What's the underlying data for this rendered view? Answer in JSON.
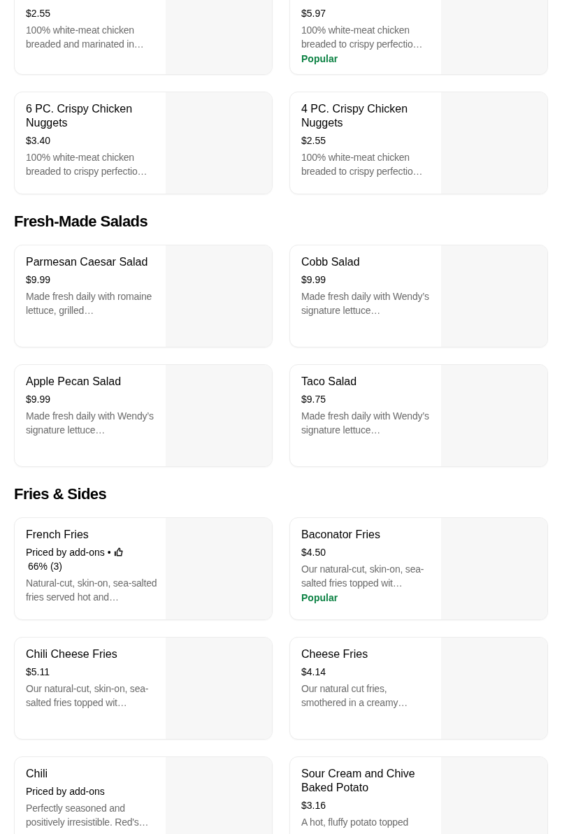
{
  "sections": [
    {
      "items": [
        {
          "price": "$2.55",
          "description": "100% white-meat chicken breaded and marinated in…"
        },
        {
          "price": "$5.97",
          "description": "100% white-meat chicken breaded to crispy perfectio…",
          "badge": "Popular"
        },
        {
          "title": "6 PC. Crispy Chicken Nuggets",
          "price": "$3.40",
          "description": "100% white-meat chicken breaded to crispy perfectio…"
        },
        {
          "title": "4 PC. Crispy Chicken Nuggets",
          "price": "$2.55",
          "description": "100% white-meat chicken breaded to crispy perfectio…"
        }
      ]
    },
    {
      "heading": "Fresh-Made Salads",
      "items": [
        {
          "title": "Parmesan Caesar Salad",
          "price": "$9.99",
          "description": "Made fresh daily with romaine lettuce, grilled…"
        },
        {
          "title": "Cobb Salad",
          "price": "$9.99",
          "description": "Made fresh daily with Wendy’s signature lettuce…"
        },
        {
          "title": "Apple Pecan Salad",
          "price": "$9.99",
          "description": "Made fresh daily with Wendy’s signature lettuce…"
        },
        {
          "title": "Taco Salad",
          "price": "$9.75",
          "description": "Made fresh daily with Wendy’s signature lettuce…"
        }
      ]
    },
    {
      "heading": "Fries & Sides",
      "items": [
        {
          "title": "French Fries",
          "price": "Priced by add-ons",
          "separator": "•",
          "rating": "66% (3)",
          "description": "Natural-cut, skin-on, sea-salted fries served hot and…"
        },
        {
          "title": "Baconator Fries",
          "price": "$4.50",
          "description": "Our natural-cut, skin-on, sea-salted fries topped wit…",
          "badge": "Popular"
        },
        {
          "title": "Chili Cheese Fries",
          "price": "$5.11",
          "description": "Our natural-cut, skin-on, sea-salted fries topped wit…"
        },
        {
          "title": "Cheese Fries",
          "price": "$4.14",
          "description": "Our natural cut fries, smothered in a creamy…"
        },
        {
          "title": "Chili",
          "price": "Priced by add-ons",
          "description": "Perfectly seasoned and positively irresistible. Red's…"
        },
        {
          "title": "Sour Cream and Chive Baked Potato",
          "price": "$3.16",
          "description": "A hot, fluffy potato topped"
        }
      ]
    }
  ]
}
